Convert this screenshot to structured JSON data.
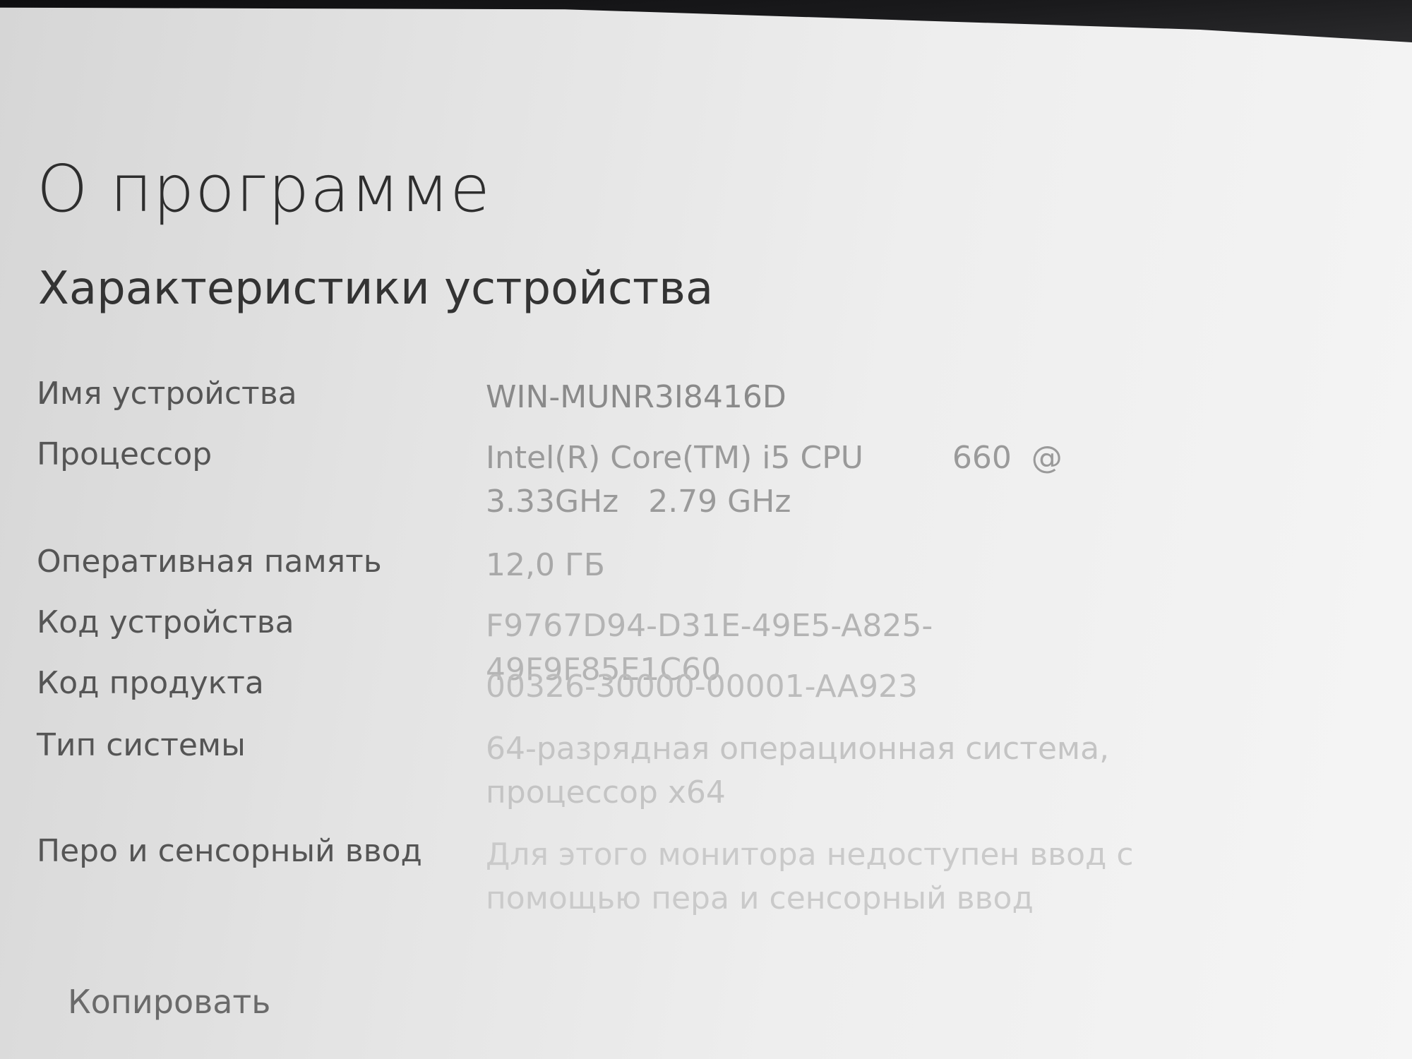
{
  "page": {
    "title": "О программе",
    "section_title": "Характеристики устройства"
  },
  "specs": [
    {
      "label": "Имя устройства",
      "value": "WIN-MUNR3I8416D"
    },
    {
      "label": "Процессор",
      "value": "Intel(R) Core(TM) i5 CPU         660  @ 3.33GHz   2.79 GHz"
    },
    {
      "label": "Оперативная память",
      "value": "12,0 ГБ"
    },
    {
      "label": "Код устройства",
      "value": "F9767D94-D31E-49E5-A825-49F9F85E1C60"
    },
    {
      "label": "Код продукта",
      "value": "00326-30000-00001-AA923"
    },
    {
      "label": "Тип системы",
      "value": "64-разрядная операционная система, процессор x64"
    },
    {
      "label": "Перо и сенсорный ввод",
      "value": "Для этого монитора недоступен ввод с помощью пера и сенсорный ввод"
    }
  ],
  "actions": {
    "copy_label": "Копировать"
  }
}
